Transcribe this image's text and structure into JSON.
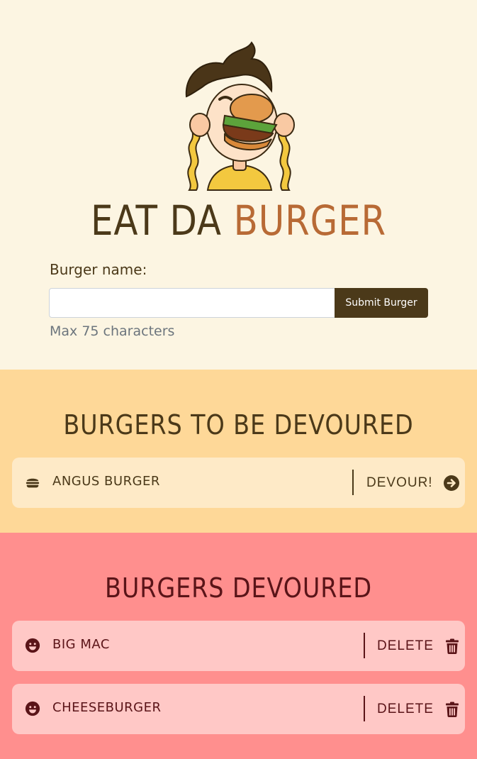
{
  "header": {
    "title_main": "EAT DA ",
    "title_accent": "BURGER"
  },
  "form": {
    "label": "Burger name:",
    "input_value": "",
    "input_placeholder": "",
    "submit_label": "Submit Burger",
    "hint": "Max 75 characters"
  },
  "to_devour": {
    "heading": "BURGERS TO BE DEVOURED",
    "items": [
      {
        "name": "ANGUS BURGER",
        "action_label": "DEVOUR!",
        "icon": "hamburger-icon",
        "action_icon": "arrow-circle-right-icon"
      }
    ]
  },
  "devoured": {
    "heading": "BURGERS DEVOURED",
    "items": [
      {
        "name": "BIG MAC",
        "action_label": "DELETE",
        "icon": "grin-tongue-icon",
        "action_icon": "trash-icon"
      },
      {
        "name": "CHEESEBURGER",
        "action_label": "DELETE",
        "icon": "grin-tongue-icon",
        "action_icon": "trash-icon"
      }
    ]
  },
  "colors": {
    "dark_brown": "#4b3919",
    "accent_brown": "#b86a35",
    "cream": "#fcf5e2",
    "todo_bg": "#fed898",
    "done_bg": "#ff8f8e",
    "done_text": "#5a1418"
  }
}
